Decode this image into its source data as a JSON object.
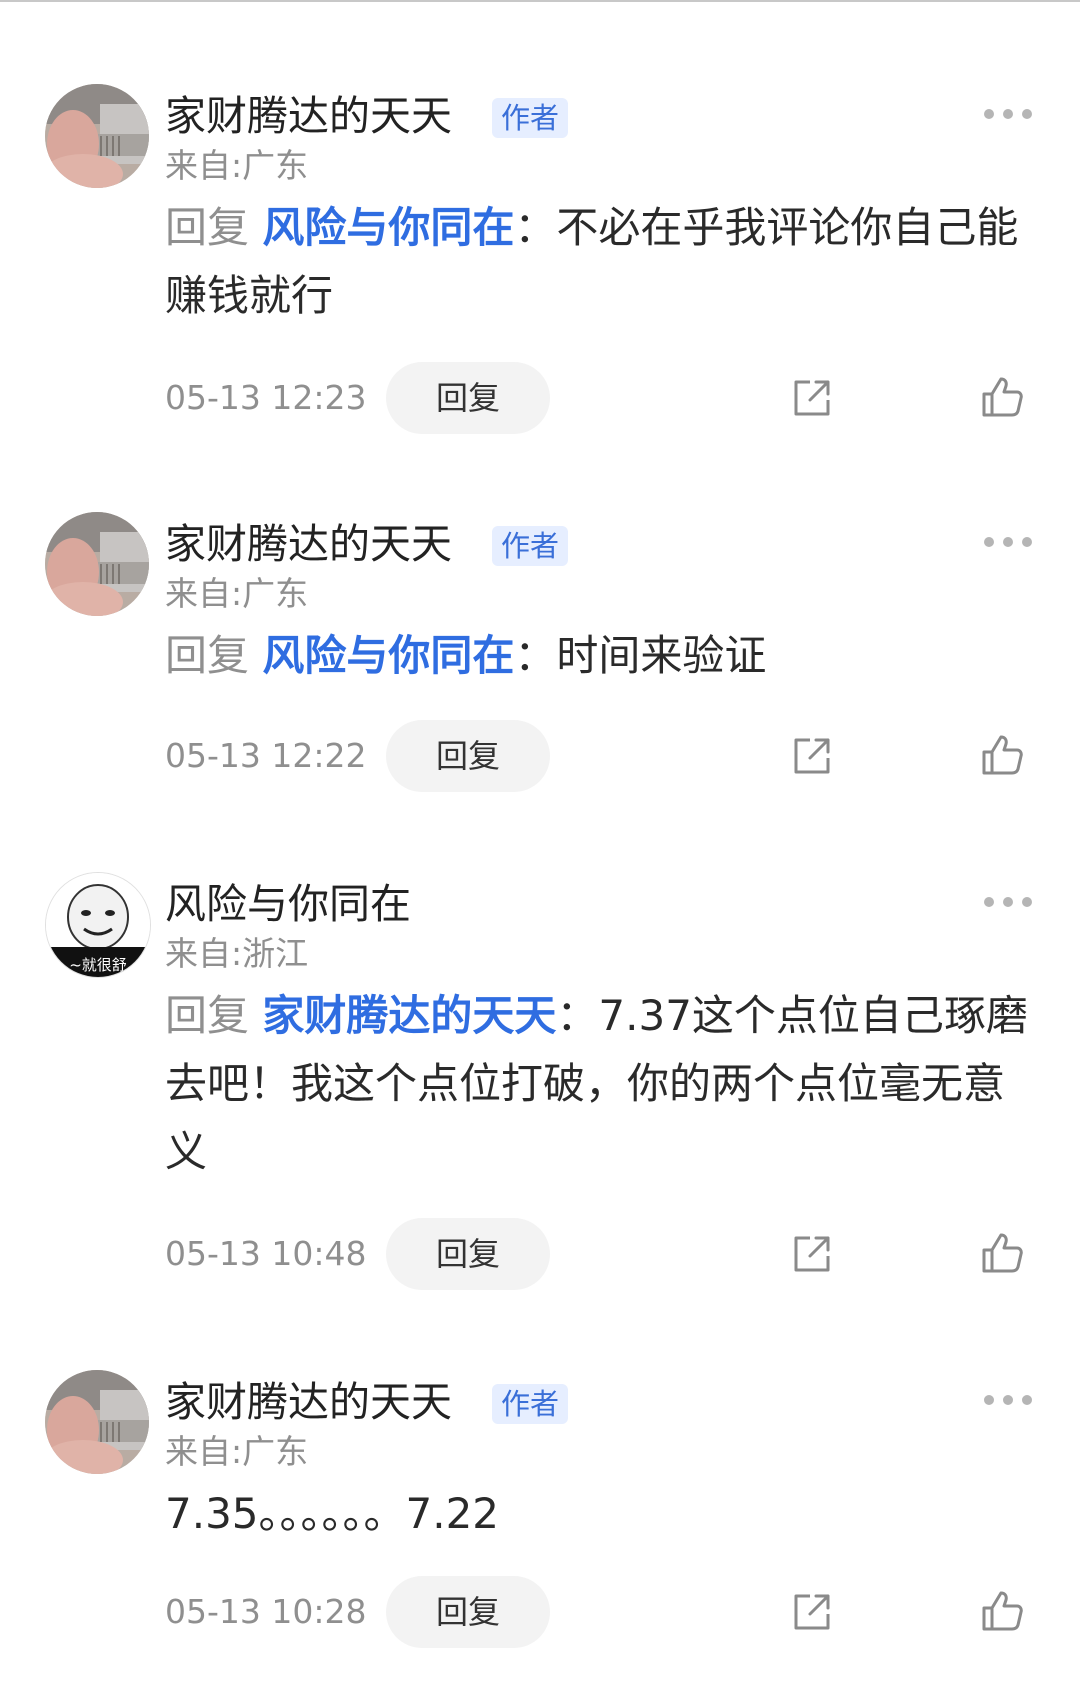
{
  "comments": [
    {
      "username": "家财腾达的天天",
      "author_badge": "作者",
      "location": "来自:广东",
      "reply_prefix": "回复",
      "reply_target": "风险与你同在",
      "separator": "：",
      "text": "不必在乎我评论你自己能赚钱就行",
      "timestamp": "05-13 12:23",
      "reply_button": "回复",
      "avatar": "photo-avatar"
    },
    {
      "username": "家财腾达的天天",
      "author_badge": "作者",
      "location": "来自:广东",
      "reply_prefix": "回复",
      "reply_target": "风险与你同在",
      "separator": "：",
      "text": "时间来验证",
      "timestamp": "05-13 12:22",
      "reply_button": "回复",
      "avatar": "photo-avatar"
    },
    {
      "username": "风险与你同在",
      "location": "来自:浙江",
      "reply_prefix": "回复",
      "reply_target": "家财腾达的天天",
      "separator": "：",
      "text": "7.37这个点位自己琢磨去吧！我这个点位打破，你的两个点位毫无意义",
      "timestamp": "05-13 10:48",
      "reply_button": "回复",
      "avatar": "meme-avatar",
      "avatar_caption": "~就很舒"
    },
    {
      "username": "家财腾达的天天",
      "author_badge": "作者",
      "location": "来自:广东",
      "text": "7.35。。。。。。7.22",
      "timestamp": "05-13 10:28",
      "reply_button": "回复",
      "avatar": "photo-avatar"
    }
  ],
  "colors": {
    "link_blue": "#2f6de1",
    "badge_text": "#3a6fd8",
    "badge_bg": "#e6eeff",
    "meta_gray": "#8f8f8f",
    "reply_bg": "#f3f3f3"
  },
  "icons": [
    "more-icon",
    "share-icon",
    "like-icon"
  ]
}
